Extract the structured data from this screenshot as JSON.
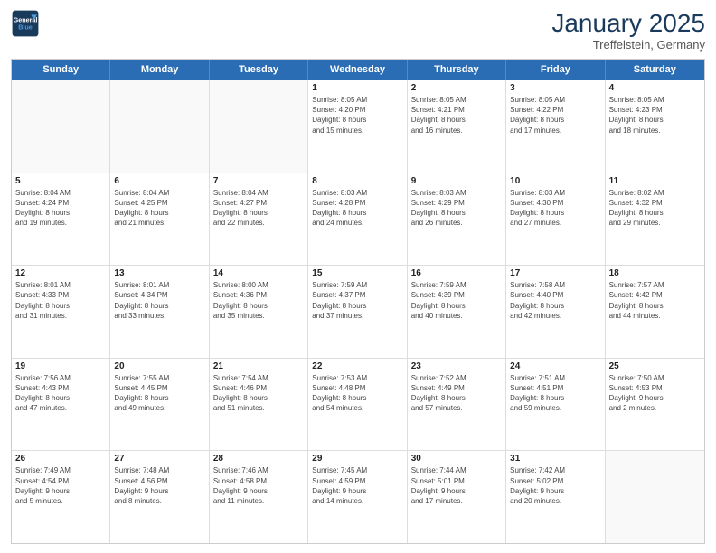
{
  "header": {
    "logo_line1": "General",
    "logo_line2": "Blue",
    "month": "January 2025",
    "location": "Treffelstein, Germany"
  },
  "days_of_week": [
    "Sunday",
    "Monday",
    "Tuesday",
    "Wednesday",
    "Thursday",
    "Friday",
    "Saturday"
  ],
  "weeks": [
    [
      {
        "day": "",
        "info": ""
      },
      {
        "day": "",
        "info": ""
      },
      {
        "day": "",
        "info": ""
      },
      {
        "day": "1",
        "info": "Sunrise: 8:05 AM\nSunset: 4:20 PM\nDaylight: 8 hours\nand 15 minutes."
      },
      {
        "day": "2",
        "info": "Sunrise: 8:05 AM\nSunset: 4:21 PM\nDaylight: 8 hours\nand 16 minutes."
      },
      {
        "day": "3",
        "info": "Sunrise: 8:05 AM\nSunset: 4:22 PM\nDaylight: 8 hours\nand 17 minutes."
      },
      {
        "day": "4",
        "info": "Sunrise: 8:05 AM\nSunset: 4:23 PM\nDaylight: 8 hours\nand 18 minutes."
      }
    ],
    [
      {
        "day": "5",
        "info": "Sunrise: 8:04 AM\nSunset: 4:24 PM\nDaylight: 8 hours\nand 19 minutes."
      },
      {
        "day": "6",
        "info": "Sunrise: 8:04 AM\nSunset: 4:25 PM\nDaylight: 8 hours\nand 21 minutes."
      },
      {
        "day": "7",
        "info": "Sunrise: 8:04 AM\nSunset: 4:27 PM\nDaylight: 8 hours\nand 22 minutes."
      },
      {
        "day": "8",
        "info": "Sunrise: 8:03 AM\nSunset: 4:28 PM\nDaylight: 8 hours\nand 24 minutes."
      },
      {
        "day": "9",
        "info": "Sunrise: 8:03 AM\nSunset: 4:29 PM\nDaylight: 8 hours\nand 26 minutes."
      },
      {
        "day": "10",
        "info": "Sunrise: 8:03 AM\nSunset: 4:30 PM\nDaylight: 8 hours\nand 27 minutes."
      },
      {
        "day": "11",
        "info": "Sunrise: 8:02 AM\nSunset: 4:32 PM\nDaylight: 8 hours\nand 29 minutes."
      }
    ],
    [
      {
        "day": "12",
        "info": "Sunrise: 8:01 AM\nSunset: 4:33 PM\nDaylight: 8 hours\nand 31 minutes."
      },
      {
        "day": "13",
        "info": "Sunrise: 8:01 AM\nSunset: 4:34 PM\nDaylight: 8 hours\nand 33 minutes."
      },
      {
        "day": "14",
        "info": "Sunrise: 8:00 AM\nSunset: 4:36 PM\nDaylight: 8 hours\nand 35 minutes."
      },
      {
        "day": "15",
        "info": "Sunrise: 7:59 AM\nSunset: 4:37 PM\nDaylight: 8 hours\nand 37 minutes."
      },
      {
        "day": "16",
        "info": "Sunrise: 7:59 AM\nSunset: 4:39 PM\nDaylight: 8 hours\nand 40 minutes."
      },
      {
        "day": "17",
        "info": "Sunrise: 7:58 AM\nSunset: 4:40 PM\nDaylight: 8 hours\nand 42 minutes."
      },
      {
        "day": "18",
        "info": "Sunrise: 7:57 AM\nSunset: 4:42 PM\nDaylight: 8 hours\nand 44 minutes."
      }
    ],
    [
      {
        "day": "19",
        "info": "Sunrise: 7:56 AM\nSunset: 4:43 PM\nDaylight: 8 hours\nand 47 minutes."
      },
      {
        "day": "20",
        "info": "Sunrise: 7:55 AM\nSunset: 4:45 PM\nDaylight: 8 hours\nand 49 minutes."
      },
      {
        "day": "21",
        "info": "Sunrise: 7:54 AM\nSunset: 4:46 PM\nDaylight: 8 hours\nand 51 minutes."
      },
      {
        "day": "22",
        "info": "Sunrise: 7:53 AM\nSunset: 4:48 PM\nDaylight: 8 hours\nand 54 minutes."
      },
      {
        "day": "23",
        "info": "Sunrise: 7:52 AM\nSunset: 4:49 PM\nDaylight: 8 hours\nand 57 minutes."
      },
      {
        "day": "24",
        "info": "Sunrise: 7:51 AM\nSunset: 4:51 PM\nDaylight: 8 hours\nand 59 minutes."
      },
      {
        "day": "25",
        "info": "Sunrise: 7:50 AM\nSunset: 4:53 PM\nDaylight: 9 hours\nand 2 minutes."
      }
    ],
    [
      {
        "day": "26",
        "info": "Sunrise: 7:49 AM\nSunset: 4:54 PM\nDaylight: 9 hours\nand 5 minutes."
      },
      {
        "day": "27",
        "info": "Sunrise: 7:48 AM\nSunset: 4:56 PM\nDaylight: 9 hours\nand 8 minutes."
      },
      {
        "day": "28",
        "info": "Sunrise: 7:46 AM\nSunset: 4:58 PM\nDaylight: 9 hours\nand 11 minutes."
      },
      {
        "day": "29",
        "info": "Sunrise: 7:45 AM\nSunset: 4:59 PM\nDaylight: 9 hours\nand 14 minutes."
      },
      {
        "day": "30",
        "info": "Sunrise: 7:44 AM\nSunset: 5:01 PM\nDaylight: 9 hours\nand 17 minutes."
      },
      {
        "day": "31",
        "info": "Sunrise: 7:42 AM\nSunset: 5:02 PM\nDaylight: 9 hours\nand 20 minutes."
      },
      {
        "day": "",
        "info": ""
      }
    ]
  ]
}
